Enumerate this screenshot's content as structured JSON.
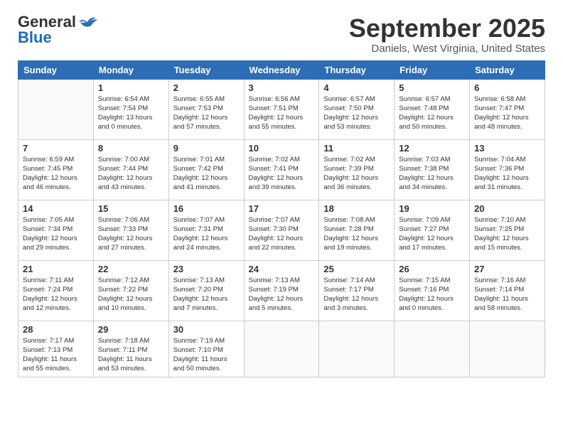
{
  "logo": {
    "general": "General",
    "blue": "Blue"
  },
  "header": {
    "month_year": "September 2025",
    "location": "Daniels, West Virginia, United States"
  },
  "weekdays": [
    "Sunday",
    "Monday",
    "Tuesday",
    "Wednesday",
    "Thursday",
    "Friday",
    "Saturday"
  ],
  "weeks": [
    [
      {
        "day": "",
        "sunrise": "",
        "sunset": "",
        "daylight": ""
      },
      {
        "day": "1",
        "sunrise": "Sunrise: 6:54 AM",
        "sunset": "Sunset: 7:54 PM",
        "daylight": "Daylight: 13 hours and 0 minutes."
      },
      {
        "day": "2",
        "sunrise": "Sunrise: 6:55 AM",
        "sunset": "Sunset: 7:53 PM",
        "daylight": "Daylight: 12 hours and 57 minutes."
      },
      {
        "day": "3",
        "sunrise": "Sunrise: 6:56 AM",
        "sunset": "Sunset: 7:51 PM",
        "daylight": "Daylight: 12 hours and 55 minutes."
      },
      {
        "day": "4",
        "sunrise": "Sunrise: 6:57 AM",
        "sunset": "Sunset: 7:50 PM",
        "daylight": "Daylight: 12 hours and 53 minutes."
      },
      {
        "day": "5",
        "sunrise": "Sunrise: 6:57 AM",
        "sunset": "Sunset: 7:48 PM",
        "daylight": "Daylight: 12 hours and 50 minutes."
      },
      {
        "day": "6",
        "sunrise": "Sunrise: 6:58 AM",
        "sunset": "Sunset: 7:47 PM",
        "daylight": "Daylight: 12 hours and 48 minutes."
      }
    ],
    [
      {
        "day": "7",
        "sunrise": "Sunrise: 6:59 AM",
        "sunset": "Sunset: 7:45 PM",
        "daylight": "Daylight: 12 hours and 46 minutes."
      },
      {
        "day": "8",
        "sunrise": "Sunrise: 7:00 AM",
        "sunset": "Sunset: 7:44 PM",
        "daylight": "Daylight: 12 hours and 43 minutes."
      },
      {
        "day": "9",
        "sunrise": "Sunrise: 7:01 AM",
        "sunset": "Sunset: 7:42 PM",
        "daylight": "Daylight: 12 hours and 41 minutes."
      },
      {
        "day": "10",
        "sunrise": "Sunrise: 7:02 AM",
        "sunset": "Sunset: 7:41 PM",
        "daylight": "Daylight: 12 hours and 39 minutes."
      },
      {
        "day": "11",
        "sunrise": "Sunrise: 7:02 AM",
        "sunset": "Sunset: 7:39 PM",
        "daylight": "Daylight: 12 hours and 36 minutes."
      },
      {
        "day": "12",
        "sunrise": "Sunrise: 7:03 AM",
        "sunset": "Sunset: 7:38 PM",
        "daylight": "Daylight: 12 hours and 34 minutes."
      },
      {
        "day": "13",
        "sunrise": "Sunrise: 7:04 AM",
        "sunset": "Sunset: 7:36 PM",
        "daylight": "Daylight: 12 hours and 31 minutes."
      }
    ],
    [
      {
        "day": "14",
        "sunrise": "Sunrise: 7:05 AM",
        "sunset": "Sunset: 7:34 PM",
        "daylight": "Daylight: 12 hours and 29 minutes."
      },
      {
        "day": "15",
        "sunrise": "Sunrise: 7:06 AM",
        "sunset": "Sunset: 7:33 PM",
        "daylight": "Daylight: 12 hours and 27 minutes."
      },
      {
        "day": "16",
        "sunrise": "Sunrise: 7:07 AM",
        "sunset": "Sunset: 7:31 PM",
        "daylight": "Daylight: 12 hours and 24 minutes."
      },
      {
        "day": "17",
        "sunrise": "Sunrise: 7:07 AM",
        "sunset": "Sunset: 7:30 PM",
        "daylight": "Daylight: 12 hours and 22 minutes."
      },
      {
        "day": "18",
        "sunrise": "Sunrise: 7:08 AM",
        "sunset": "Sunset: 7:28 PM",
        "daylight": "Daylight: 12 hours and 19 minutes."
      },
      {
        "day": "19",
        "sunrise": "Sunrise: 7:09 AM",
        "sunset": "Sunset: 7:27 PM",
        "daylight": "Daylight: 12 hours and 17 minutes."
      },
      {
        "day": "20",
        "sunrise": "Sunrise: 7:10 AM",
        "sunset": "Sunset: 7:25 PM",
        "daylight": "Daylight: 12 hours and 15 minutes."
      }
    ],
    [
      {
        "day": "21",
        "sunrise": "Sunrise: 7:11 AM",
        "sunset": "Sunset: 7:24 PM",
        "daylight": "Daylight: 12 hours and 12 minutes."
      },
      {
        "day": "22",
        "sunrise": "Sunrise: 7:12 AM",
        "sunset": "Sunset: 7:22 PM",
        "daylight": "Daylight: 12 hours and 10 minutes."
      },
      {
        "day": "23",
        "sunrise": "Sunrise: 7:13 AM",
        "sunset": "Sunset: 7:20 PM",
        "daylight": "Daylight: 12 hours and 7 minutes."
      },
      {
        "day": "24",
        "sunrise": "Sunrise: 7:13 AM",
        "sunset": "Sunset: 7:19 PM",
        "daylight": "Daylight: 12 hours and 5 minutes."
      },
      {
        "day": "25",
        "sunrise": "Sunrise: 7:14 AM",
        "sunset": "Sunset: 7:17 PM",
        "daylight": "Daylight: 12 hours and 3 minutes."
      },
      {
        "day": "26",
        "sunrise": "Sunrise: 7:15 AM",
        "sunset": "Sunset: 7:16 PM",
        "daylight": "Daylight: 12 hours and 0 minutes."
      },
      {
        "day": "27",
        "sunrise": "Sunrise: 7:16 AM",
        "sunset": "Sunset: 7:14 PM",
        "daylight": "Daylight: 11 hours and 58 minutes."
      }
    ],
    [
      {
        "day": "28",
        "sunrise": "Sunrise: 7:17 AM",
        "sunset": "Sunset: 7:13 PM",
        "daylight": "Daylight: 11 hours and 55 minutes."
      },
      {
        "day": "29",
        "sunrise": "Sunrise: 7:18 AM",
        "sunset": "Sunset: 7:11 PM",
        "daylight": "Daylight: 11 hours and 53 minutes."
      },
      {
        "day": "30",
        "sunrise": "Sunrise: 7:19 AM",
        "sunset": "Sunset: 7:10 PM",
        "daylight": "Daylight: 11 hours and 50 minutes."
      },
      {
        "day": "",
        "sunrise": "",
        "sunset": "",
        "daylight": ""
      },
      {
        "day": "",
        "sunrise": "",
        "sunset": "",
        "daylight": ""
      },
      {
        "day": "",
        "sunrise": "",
        "sunset": "",
        "daylight": ""
      },
      {
        "day": "",
        "sunrise": "",
        "sunset": "",
        "daylight": ""
      }
    ]
  ]
}
